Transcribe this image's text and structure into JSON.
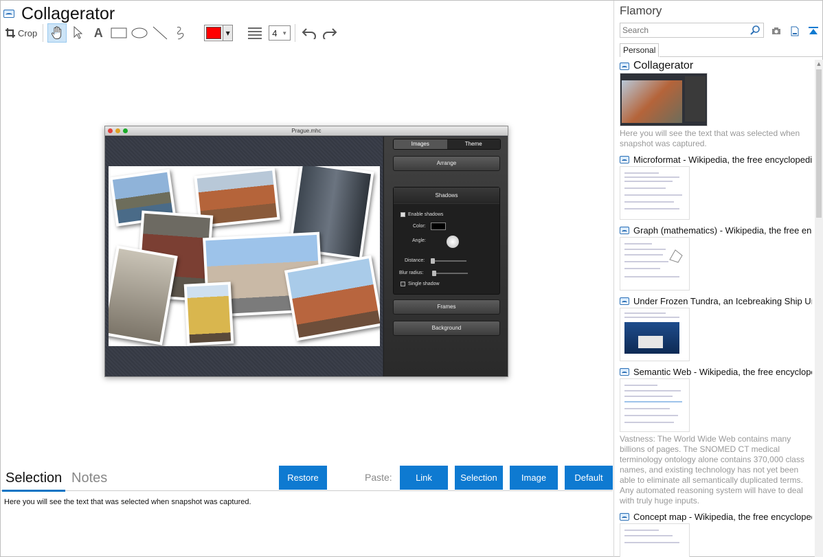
{
  "app": {
    "title": "Collagerator"
  },
  "toolbar": {
    "crop_label": "Crop",
    "line_width": "4",
    "color": "#ff0000"
  },
  "screenshot": {
    "window_title": "Prague.mhc",
    "seg_tabs": [
      "Images",
      "Theme"
    ],
    "buttons": {
      "arrange": "Arrange",
      "frames": "Frames",
      "background": "Background"
    },
    "shadows": {
      "header": "Shadows",
      "enable": "Enable shadows",
      "color": "Color:",
      "angle": "Angle:",
      "distance": "Distance:",
      "blur": "Blur radius:",
      "single": "Single shadow"
    }
  },
  "bottom": {
    "tabs": [
      "Selection",
      "Notes"
    ],
    "restore": "Restore",
    "paste_label": "Paste:",
    "paste_buttons": [
      "Link",
      "Selection",
      "Image",
      "Default"
    ],
    "selection_text": "Here you will see the text that was selected when snapshot was captured."
  },
  "sidebar": {
    "title": "Flamory",
    "search_placeholder": "Search",
    "tab": "Personal",
    "items": [
      {
        "title": "Collagerator",
        "desc": "Here you will see the text that was selected when snapshot was captured."
      },
      {
        "title": "Microformat - Wikipedia, the free encyclopedia"
      },
      {
        "title": "Graph (mathematics) - Wikipedia, the free encyclopedia"
      },
      {
        "title": "Under Frozen Tundra, an Icebreaking Ship Uncovers"
      },
      {
        "title": "Semantic Web - Wikipedia, the free encyclopedia",
        "desc": "Vastness: The World Wide Web contains many billions of pages. The SNOMED CT medical terminology ontology alone contains 370,000 class names, and existing technology has not yet been able to eliminate all semantically duplicated terms. Any automated reasoning system will have to deal with truly huge inputs."
      },
      {
        "title": "Concept map - Wikipedia, the free encyclopedia"
      }
    ]
  },
  "colors": {
    "accent": "#0e7ad1",
    "tab_underline": "#0a74c4"
  }
}
